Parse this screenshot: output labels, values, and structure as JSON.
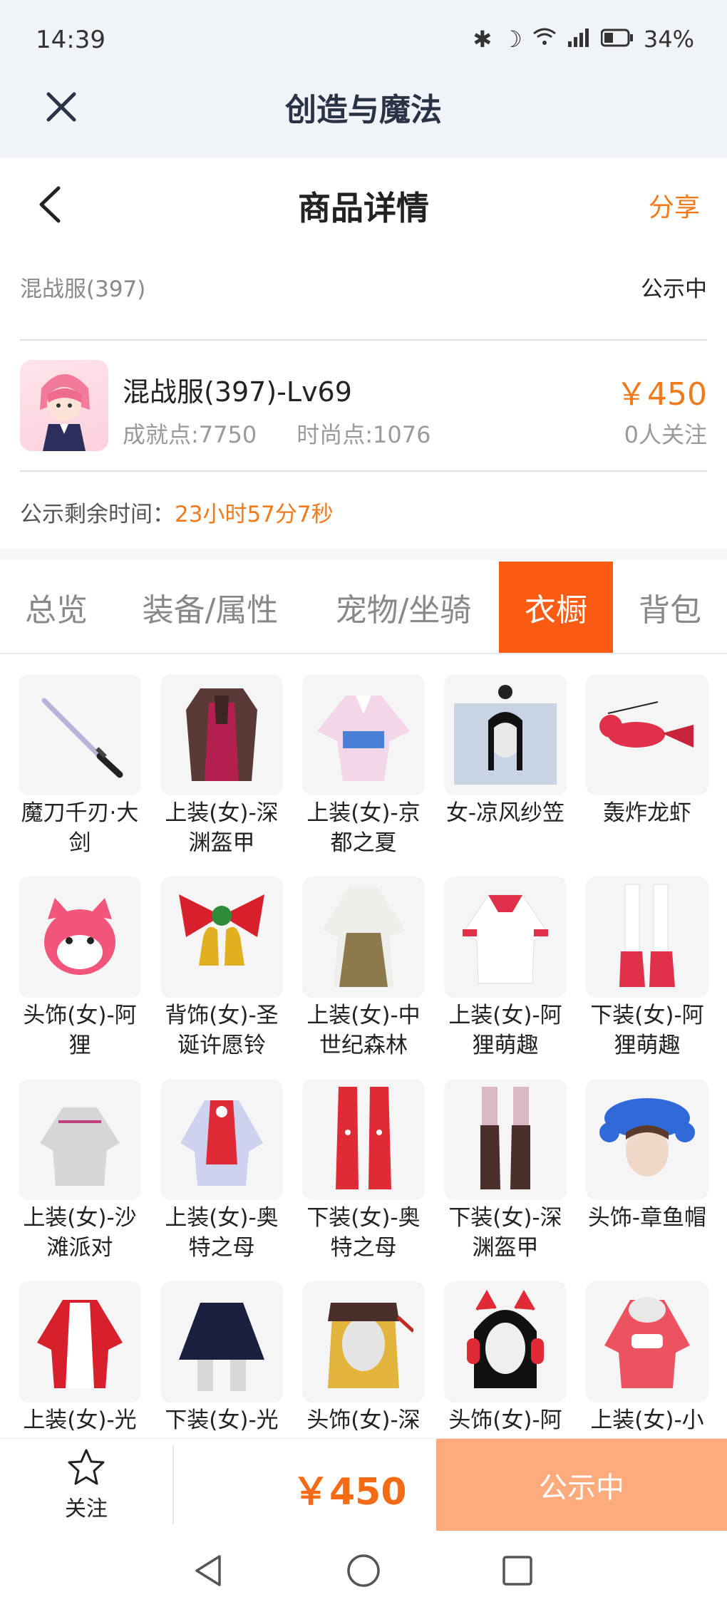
{
  "status_bar": {
    "time": "14:39",
    "battery": "34%"
  },
  "app": {
    "title": "创造与魔法"
  },
  "page": {
    "title": "商品详情",
    "share": "分享"
  },
  "server": {
    "name": "混战服(397)",
    "status": "公示中"
  },
  "character": {
    "name": "混战服(397)-Lv69",
    "achievement": "成就点:7750",
    "fashion": "时尚点:1076",
    "price": "￥450",
    "followers": "0人关注"
  },
  "timer": {
    "label": "公示剩余时间：",
    "value": "23小时57分7秒"
  },
  "tabs": [
    {
      "label": "总览",
      "active": false
    },
    {
      "label": "装备/属性",
      "active": false
    },
    {
      "label": "宠物/坐骑",
      "active": false
    },
    {
      "label": "衣橱",
      "active": true
    },
    {
      "label": "背包",
      "active": false
    }
  ],
  "wardrobe": [
    {
      "label": "魔刀千刃·大剑",
      "icon": "sword-icon"
    },
    {
      "label": "上装(女)-深渊盔甲",
      "icon": "armor-top-icon"
    },
    {
      "label": "上装(女)-京都之夏",
      "icon": "kimono-icon"
    },
    {
      "label": "女-凉风纱笠",
      "icon": "veil-hat-icon"
    },
    {
      "label": "轰炸龙虾",
      "icon": "lobster-icon"
    },
    {
      "label": "头饰(女)-阿狸",
      "icon": "fox-head-icon"
    },
    {
      "label": "背饰(女)-圣诞许愿铃",
      "icon": "bell-icon"
    },
    {
      "label": "上装(女)-中世纪森林",
      "icon": "dress-icon"
    },
    {
      "label": "上装(女)-阿狸萌趣",
      "icon": "jacket-icon"
    },
    {
      "label": "下装(女)-阿狸萌趣",
      "icon": "boots-icon"
    },
    {
      "label": "上装(女)-沙滩派对",
      "icon": "top-icon"
    },
    {
      "label": "上装(女)-奥特之母",
      "icon": "suit-top-icon"
    },
    {
      "label": "下装(女)-奥特之母",
      "icon": "red-boots-icon"
    },
    {
      "label": "下装(女)-深渊盔甲",
      "icon": "dark-boots-icon"
    },
    {
      "label": "头饰-章鱼帽",
      "icon": "octopus-hat-icon"
    },
    {
      "label": "上装(女)-光",
      "icon": "red-jacket-icon"
    },
    {
      "label": "下装(女)-光",
      "icon": "skirt-icon"
    },
    {
      "label": "头饰(女)-深",
      "icon": "blonde-hair-icon"
    },
    {
      "label": "头饰(女)-阿",
      "icon": "headphones-icon"
    },
    {
      "label": "上装(女)-小",
      "icon": "hoodie-icon"
    }
  ],
  "bottom": {
    "follow": "关注",
    "price": "￥450",
    "status": "公示中"
  },
  "colors": {
    "accent": "#f07a1c",
    "tab_active": "#fc5b14",
    "button": "#fdaa7c"
  }
}
